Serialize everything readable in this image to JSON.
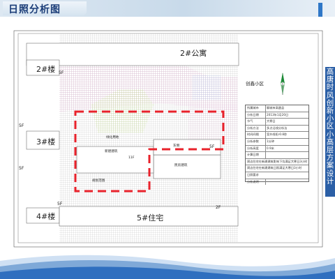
{
  "header": {
    "title": "日照分析图"
  },
  "side_title": "高唐时风创新小区小高层方案设计",
  "drawing": {
    "district": "创鑫小区",
    "buildings": {
      "b2_apartment": "2#公寓",
      "b2": "2#楼",
      "b3": "3#楼",
      "b4": "4#楼",
      "b5": "5#住宅"
    },
    "floors": {
      "f1": "5F",
      "f2": "5F",
      "f3": "5F",
      "f4": "2F",
      "f5": "5F",
      "f6": "5F"
    },
    "notes": {
      "n_tree": "绿化用地",
      "n_new": "新建建筑",
      "n_side": "东侧",
      "n_f11": "11F",
      "n_area": "规划范围",
      "n_house": "民房建筑"
    }
  },
  "info_table": {
    "rows": [
      {
        "k": "所属城市",
        "v": "聊城市高唐县"
      },
      {
        "k": "分析日期",
        "v": "2013年1月20日"
      },
      {
        "k": "节气",
        "v": "大寒日"
      },
      {
        "k": "分析方法",
        "v": "多点沿线分析法"
      },
      {
        "k": "时间间隔",
        "v": "室外线阳-6:8秒"
      },
      {
        "k": "分析参数",
        "v": "1分钟"
      },
      {
        "k": "分析高度",
        "v": "0.9米"
      },
      {
        "k": "计算日期",
        "v": ""
      },
      {
        "k": "分析说明",
        "v": ""
      }
    ],
    "notes": [
      "周边住宅在新建建筑影响下均满足大寒日3小时",
      "周边住宅在新建建筑日照满足大寒日3小时",
      "日照要求"
    ]
  },
  "colors": {
    "header_text": "#1b3d78",
    "side_bar": "#2b5fa6",
    "boundary": "#e8222b",
    "hatch_pink": "#d8a9cc",
    "hatch_green": "#b9d57e"
  }
}
